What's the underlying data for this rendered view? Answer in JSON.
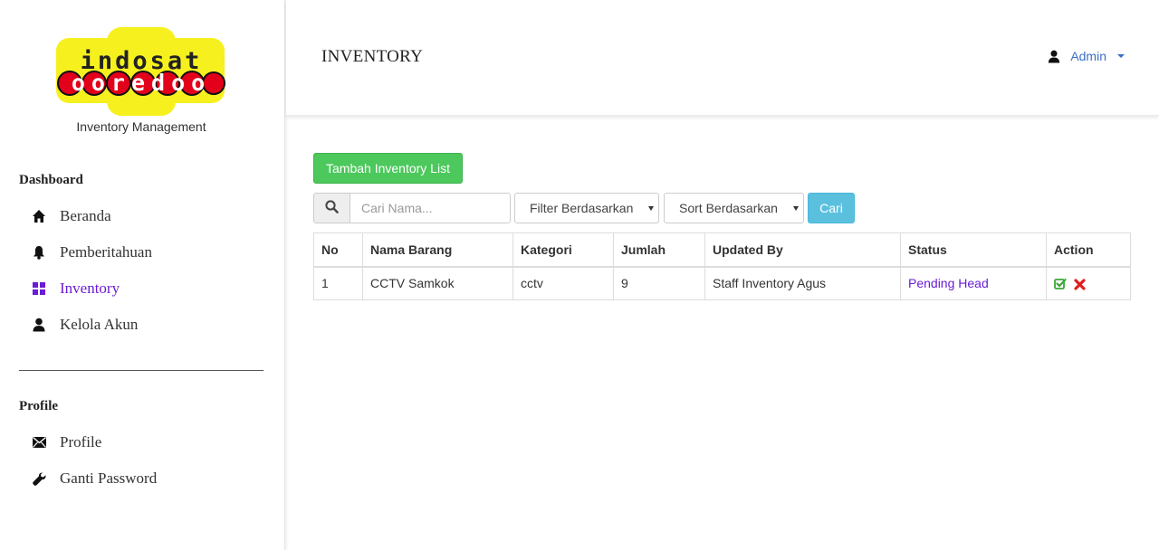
{
  "brand": {
    "logo_top": "indosat",
    "logo_bottom": "ooredoo",
    "subtitle": "Inventory Management"
  },
  "sidebar": {
    "section_dashboard": "Dashboard",
    "dashboard_items": [
      {
        "label": "Beranda",
        "icon": "home-icon"
      },
      {
        "label": "Pemberitahuan",
        "icon": "bell-icon"
      },
      {
        "label": "Inventory",
        "icon": "grid-icon",
        "active": true
      },
      {
        "label": "Kelola Akun",
        "icon": "user-icon"
      }
    ],
    "section_profile": "Profile",
    "profile_items": [
      {
        "label": "Profile",
        "icon": "envelope-icon"
      },
      {
        "label": "Ganti Password",
        "icon": "wrench-icon"
      }
    ]
  },
  "header": {
    "title": "INVENTORY",
    "user": "Admin"
  },
  "toolbar": {
    "add_label": "Tambah Inventory List",
    "search_placeholder": "Cari Nama...",
    "filter_label": "Filter Berdasarkan",
    "sort_label": "Sort Berdasarkan",
    "search_button": "Cari"
  },
  "table": {
    "columns": [
      "No",
      "Nama Barang",
      "Kategori",
      "Jumlah",
      "Updated By",
      "Status",
      "Action"
    ],
    "rows": [
      {
        "no": "1",
        "nama": "CCTV Samkok",
        "kategori": "cctv",
        "jumlah": "9",
        "updated_by": "Staff Inventory Agus",
        "status": "Pending Head"
      }
    ]
  },
  "colors": {
    "accent_active": "#6a1cd6",
    "add_button": "#4cc85c",
    "search_button": "#5bc0de",
    "link_blue": "#3b6fc4",
    "approve_green": "#3aa83a",
    "reject_red": "#e01e1e",
    "logo_yellow": "#f6f01e",
    "logo_red": "#e3001b"
  }
}
